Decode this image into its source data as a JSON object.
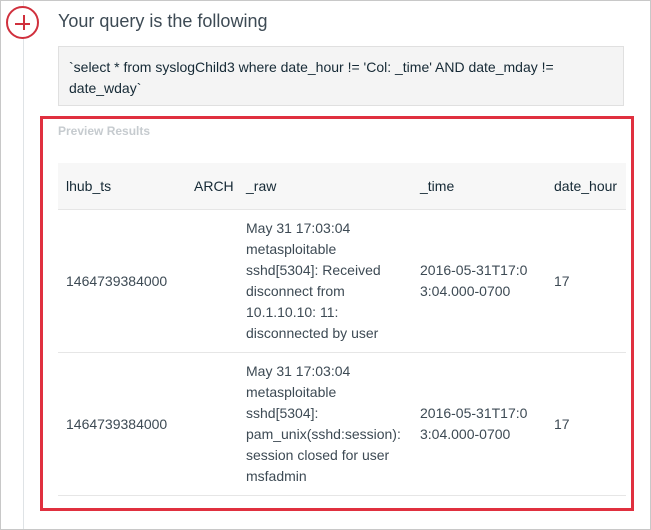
{
  "query": {
    "title": "Your query is the following",
    "text": "`select * from syslogChild3 where date_hour != 'Col: _time' AND date_mday != date_wday`"
  },
  "preview": {
    "title": "Preview Results",
    "columns": [
      "lhub_ts",
      "ARCH",
      "_raw",
      "_time",
      "date_hour"
    ],
    "rows": [
      {
        "lhub_ts": "1464739384000",
        "arch": "",
        "raw": "May 31 17:03:04 metasploitable sshd[5304]: Received disconnect from 10.1.10.10: 11: disconnected by user",
        "time": "2016-05-31T17:03:04.000-0700",
        "date_hour": "17"
      },
      {
        "lhub_ts": "1464739384000",
        "arch": "",
        "raw": "May 31 17:03:04 metasploitable sshd[5304]: pam_unix(sshd:session): session closed for user msfadmin",
        "time": "2016-05-31T17:03:04.000-0700",
        "date_hour": "17"
      }
    ]
  },
  "colors": {
    "accent": "#e0303f",
    "add_button": "#d0303d"
  }
}
